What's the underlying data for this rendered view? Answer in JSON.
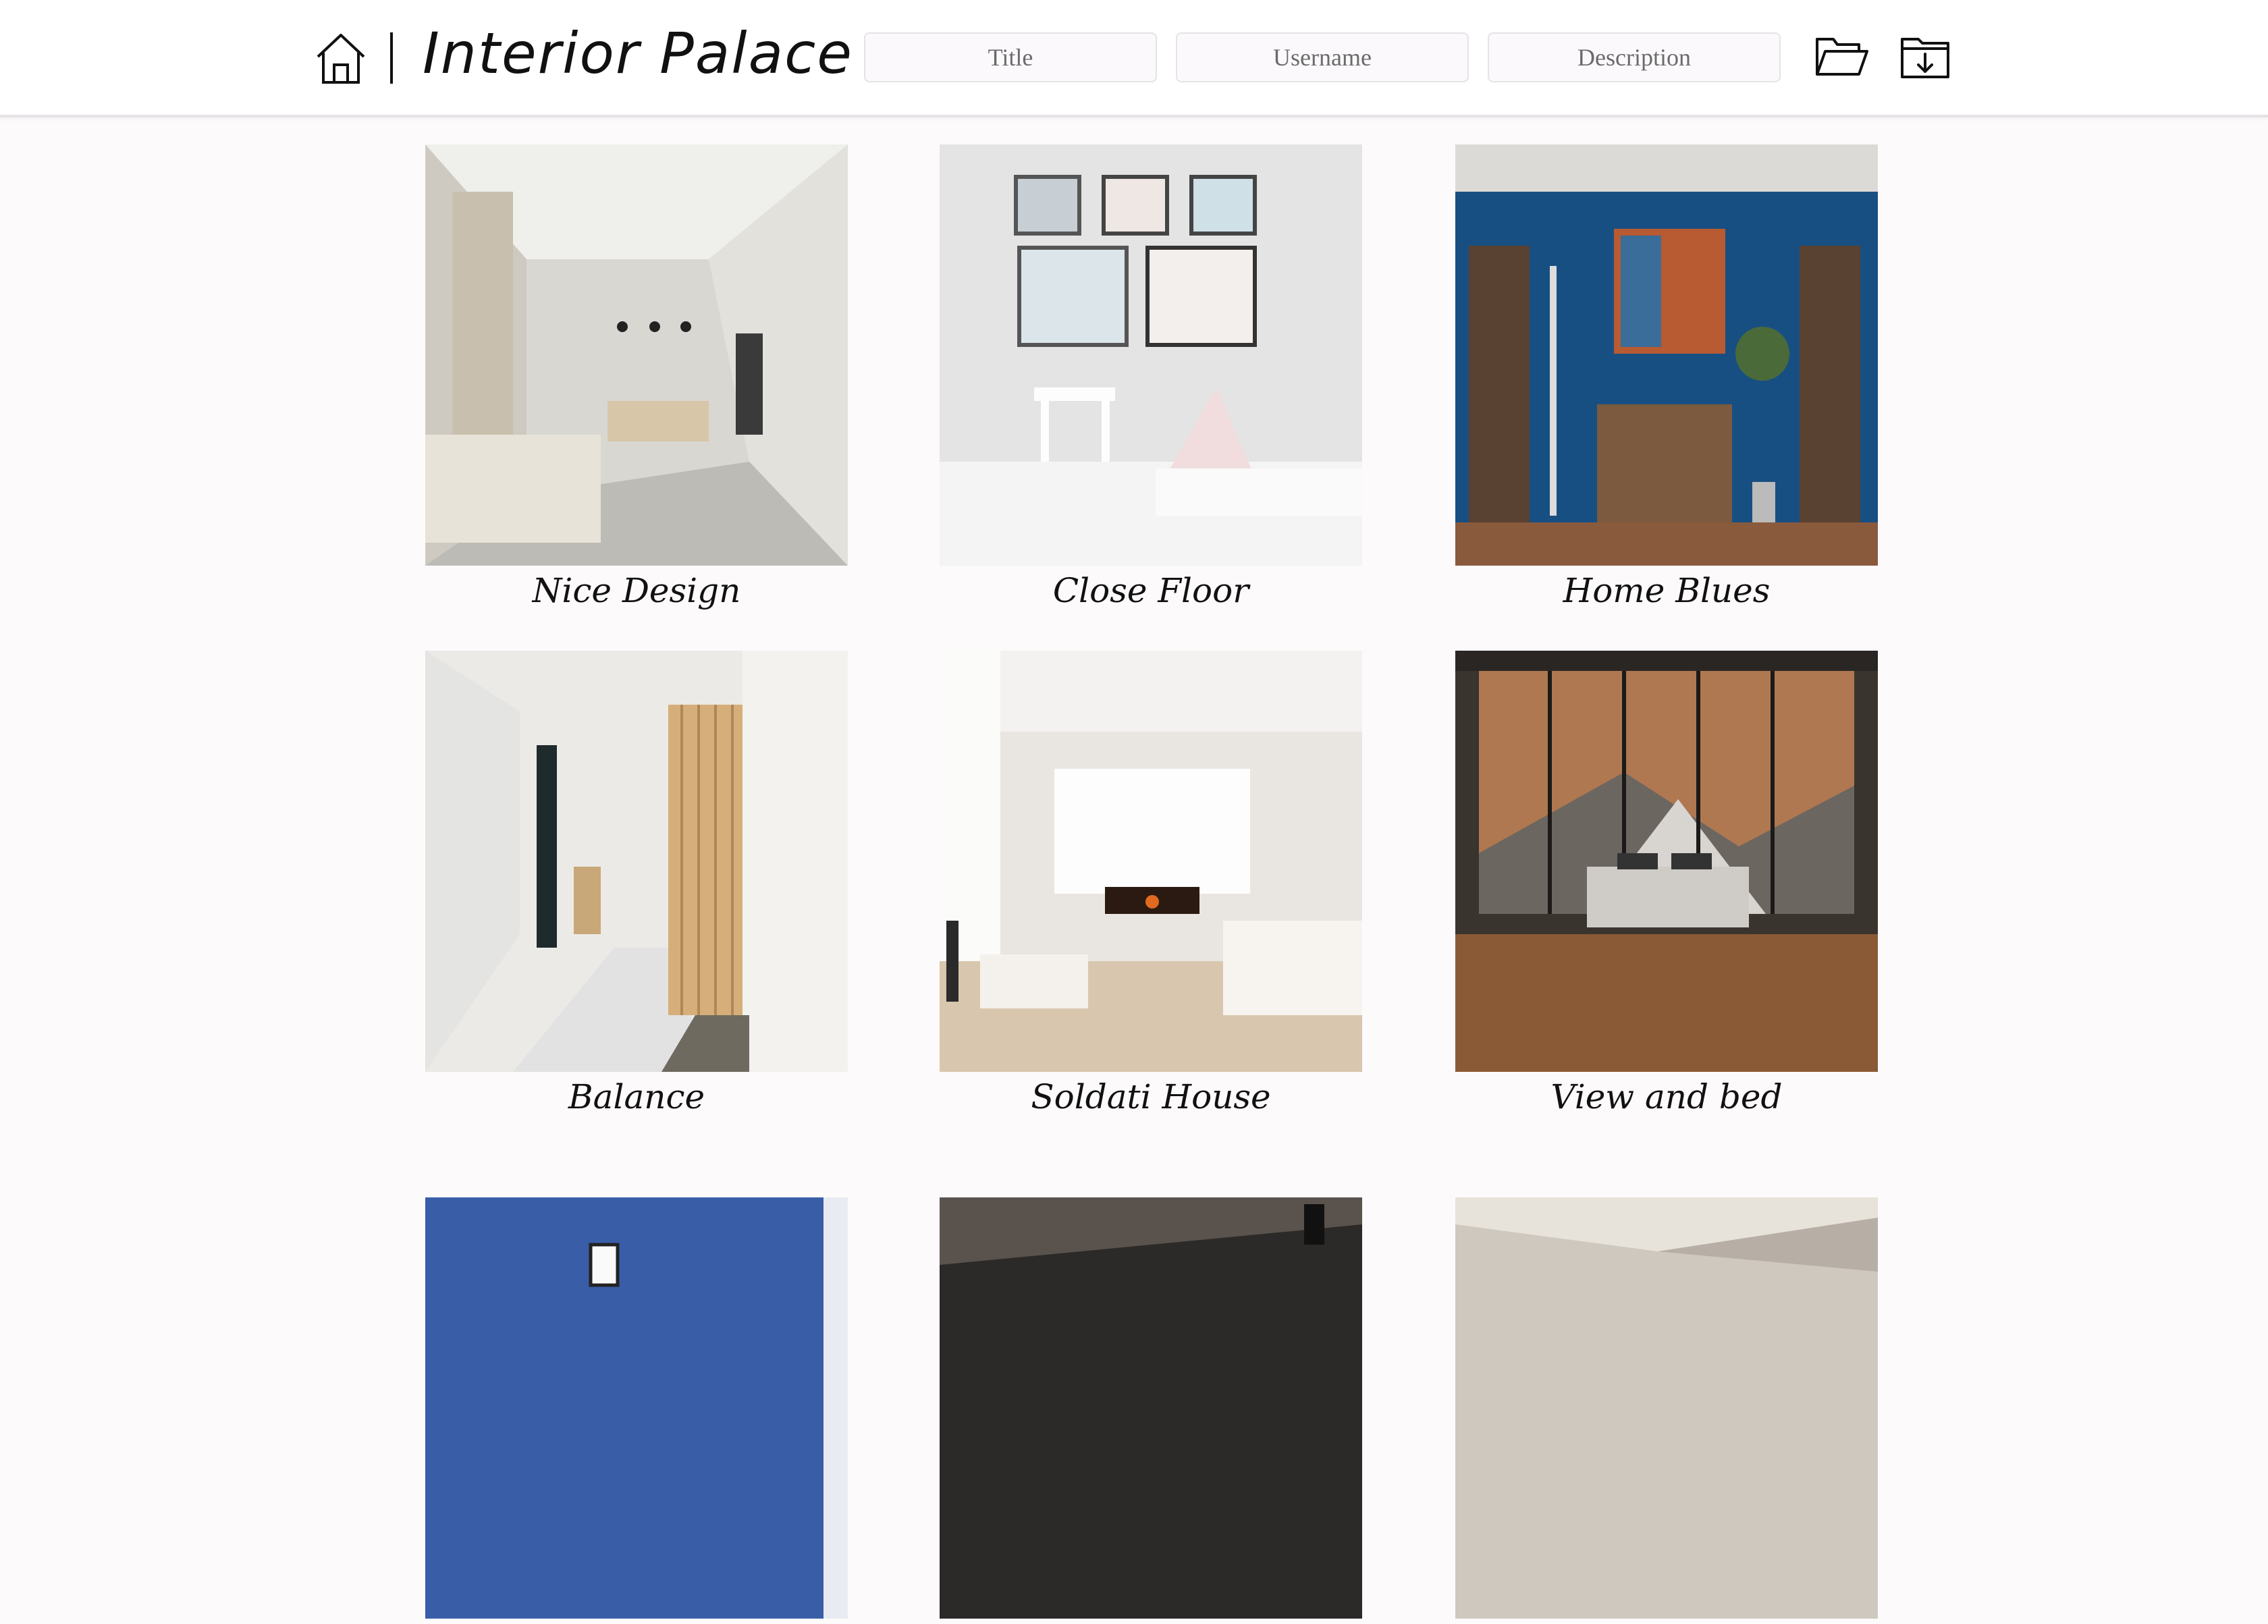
{
  "app": {
    "title": "Interior Palace",
    "icons": {
      "home": "home-icon",
      "open_folder": "folder-open-icon",
      "download_folder": "folder-download-icon"
    }
  },
  "search": {
    "title_placeholder": "Title",
    "username_placeholder": "Username",
    "description_placeholder": "Description"
  },
  "gallery": {
    "items": [
      {
        "title": "Nice Design"
      },
      {
        "title": "Close Floor"
      },
      {
        "title": "Home Blues"
      },
      {
        "title": "Balance"
      },
      {
        "title": "Soldati House"
      },
      {
        "title": "View and bed"
      },
      {
        "title": ""
      },
      {
        "title": ""
      },
      {
        "title": ""
      }
    ]
  },
  "colors": {
    "background": "#fdfafc",
    "header": "#ffffff",
    "text": "#111111"
  }
}
